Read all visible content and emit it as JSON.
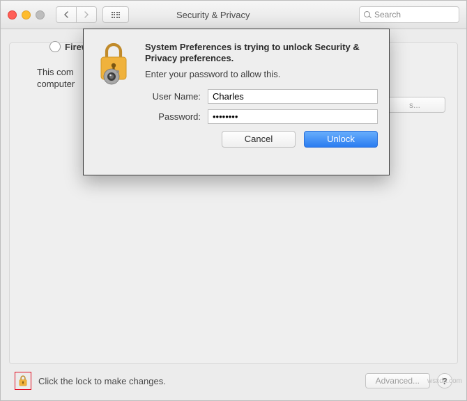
{
  "toolbar": {
    "title": "Security & Privacy",
    "search_placeholder": "Search"
  },
  "body": {
    "tab_label": "Firew",
    "description_line1": "This com",
    "description_line2": "computer",
    "options_label": "s...",
    "bottom_text": "Click the lock to make changes.",
    "advanced_label": "Advanced...",
    "help_label": "?"
  },
  "dialog": {
    "heading": "System Preferences is trying to unlock Security & Privacy preferences.",
    "subheading": "Enter your password to allow this.",
    "username_label": "User Name:",
    "username_value": "Charles",
    "password_label": "Password:",
    "password_value": "••••••••",
    "cancel_label": "Cancel",
    "unlock_label": "Unlock"
  },
  "watermark": "wsxdn.com"
}
